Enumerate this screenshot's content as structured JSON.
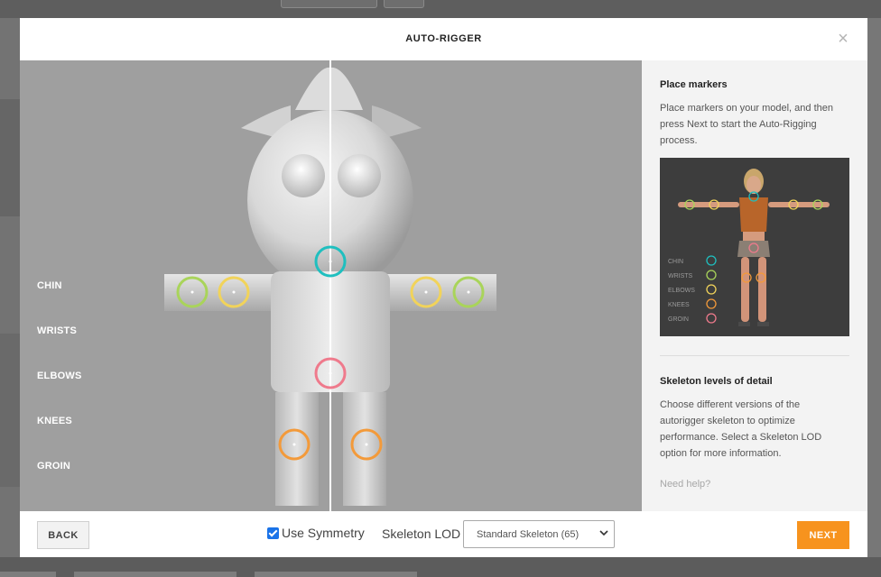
{
  "modal": {
    "title": "AUTO-RIGGER",
    "close_icon": "close-icon"
  },
  "viewport": {
    "marker_labels": [
      "CHIN",
      "WRISTS",
      "ELBOWS",
      "KNEES",
      "GROIN"
    ],
    "marker_colors": {
      "chin": "#1fbfbf",
      "wrists": "#a9d45a",
      "elbows": "#f1d35a",
      "knees": "#f39a3a",
      "groin": "#ef7a8c"
    }
  },
  "sidebar": {
    "place_title": "Place markers",
    "place_text": "Place markers on your model, and then press Next to start the Auto-Rigging process.",
    "reference_legend": [
      "CHIN",
      "WRISTS",
      "ELBOWS",
      "KNEES",
      "GROIN"
    ],
    "lod_title": "Skeleton levels of detail",
    "lod_text": "Choose different versions of the autorigger skeleton to optimize performance. Select a Skeleton LOD option for more information.",
    "help_link": "Need help?"
  },
  "footer": {
    "back_label": "BACK",
    "symmetry_label": "Use Symmetry",
    "symmetry_checked": true,
    "lod_label": "Skeleton LOD",
    "lod_value": "Standard Skeleton (65)",
    "next_label": "NEXT"
  },
  "colors": {
    "accent": "#f7931e",
    "checkbox": "#1a73e8"
  }
}
